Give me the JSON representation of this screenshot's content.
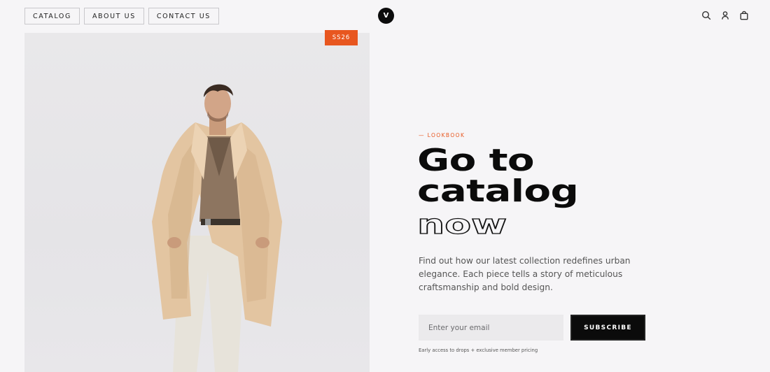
{
  "nav": {
    "items": [
      {
        "label": "CATALOG"
      },
      {
        "label": "ABOUT US"
      },
      {
        "label": "CONTACT US"
      }
    ]
  },
  "brand": {
    "logo_letter": "V"
  },
  "header_icons": [
    "search-icon",
    "user-icon",
    "bag-icon"
  ],
  "hero": {
    "badge": "SS26"
  },
  "content": {
    "kicker": "— LOOKBOOK",
    "headline_line1": "Go to",
    "headline_line2": "catalog",
    "headline_outline": "now",
    "paragraph": "Find out how our latest collection redefines urban elegance. Each piece tells a story of meticulous craftsmanship and bold design."
  },
  "signup": {
    "email_placeholder": "Enter your email",
    "button_label": "SUBSCRIBE",
    "note": "Early access to drops + exclusive member pricing"
  },
  "colors": {
    "accent": "#e8561f",
    "background": "#f6f5f7",
    "ink": "#0b0b0b"
  }
}
